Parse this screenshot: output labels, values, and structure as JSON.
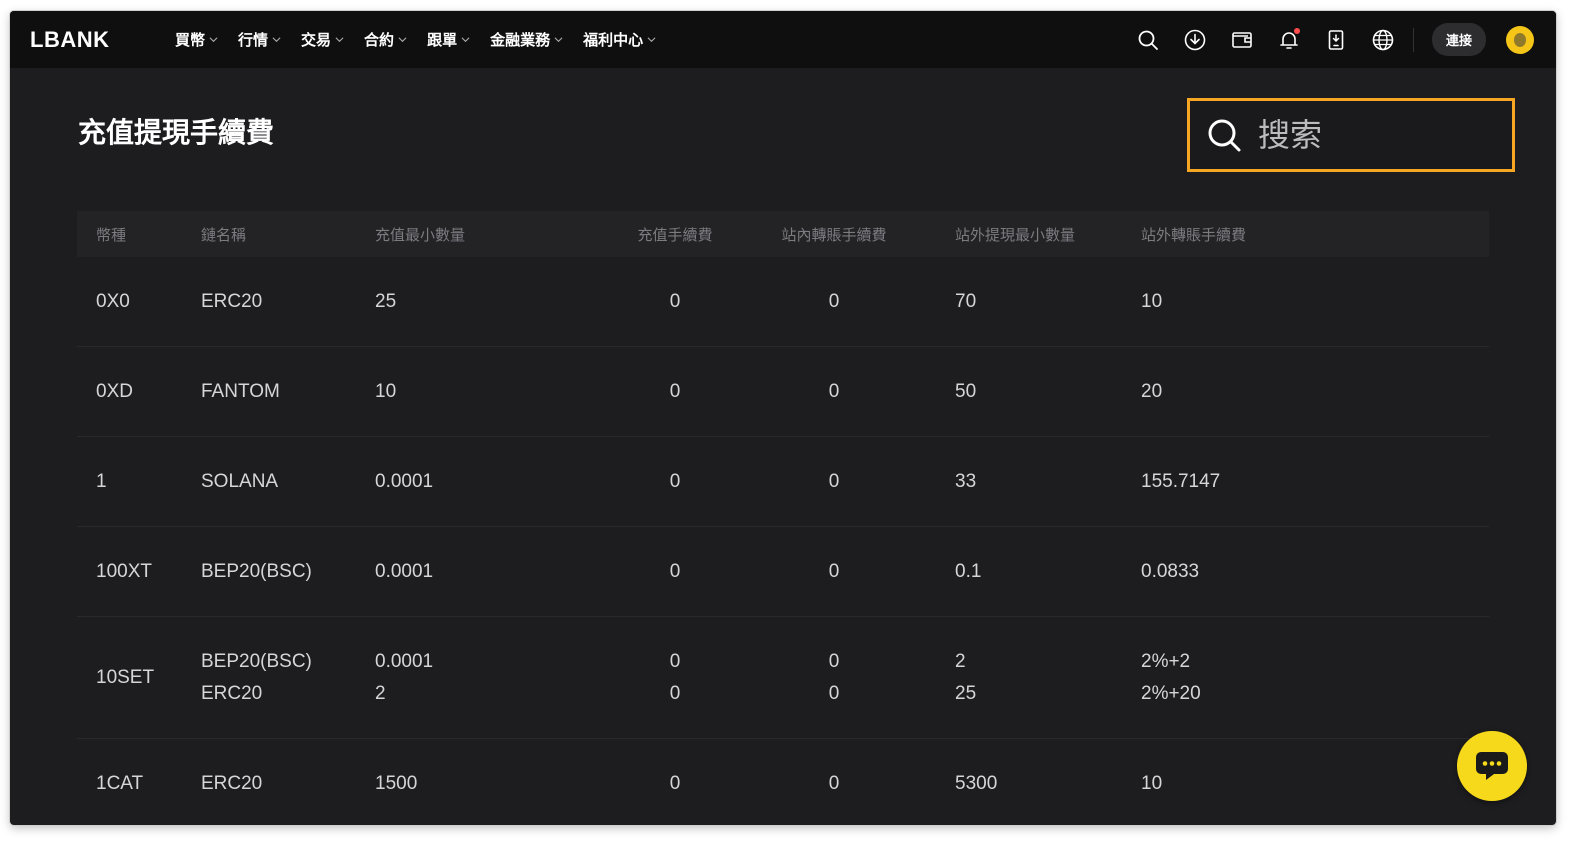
{
  "nav": {
    "logo": "LBANK",
    "menu": [
      {
        "label": "買幣"
      },
      {
        "label": "行情"
      },
      {
        "label": "交易"
      },
      {
        "label": "合約"
      },
      {
        "label": "跟單"
      },
      {
        "label": "金融業務"
      },
      {
        "label": "福利中心"
      }
    ],
    "icons": [
      "search-icon",
      "download-icon",
      "wallet-icon",
      "bell-icon",
      "mobile-icon",
      "globe-icon"
    ],
    "connect_label": "連接"
  },
  "page": {
    "title": "充值提現手續費"
  },
  "search": {
    "placeholder": "搜索",
    "accent": "#f5a623"
  },
  "table": {
    "headers": [
      "幣種",
      "鏈名稱",
      "充值最小數量",
      "充值手續費",
      "站內轉賬手續費",
      "站外提現最小數量",
      "站外轉賬手續費"
    ],
    "rows": [
      {
        "coin": "0X0",
        "chains": [
          {
            "chain": "ERC20",
            "min_deposit": "25",
            "deposit_fee": "0",
            "internal_fee": "0",
            "min_withdraw": "70",
            "withdraw_fee": "10"
          }
        ]
      },
      {
        "coin": "0XD",
        "chains": [
          {
            "chain": "FANTOM",
            "min_deposit": "10",
            "deposit_fee": "0",
            "internal_fee": "0",
            "min_withdraw": "50",
            "withdraw_fee": "20"
          }
        ]
      },
      {
        "coin": "1",
        "chains": [
          {
            "chain": "SOLANA",
            "min_deposit": "0.0001",
            "deposit_fee": "0",
            "internal_fee": "0",
            "min_withdraw": "33",
            "withdraw_fee": "155.7147"
          }
        ]
      },
      {
        "coin": "100XT",
        "chains": [
          {
            "chain": "BEP20(BSC)",
            "min_deposit": "0.0001",
            "deposit_fee": "0",
            "internal_fee": "0",
            "min_withdraw": "0.1",
            "withdraw_fee": "0.0833"
          }
        ]
      },
      {
        "coin": "10SET",
        "chains": [
          {
            "chain": "BEP20(BSC)",
            "min_deposit": "0.0001",
            "deposit_fee": "0",
            "internal_fee": "0",
            "min_withdraw": "2",
            "withdraw_fee": "2%+2"
          },
          {
            "chain": "ERC20",
            "min_deposit": "2",
            "deposit_fee": "0",
            "internal_fee": "0",
            "min_withdraw": "25",
            "withdraw_fee": "2%+20"
          }
        ]
      },
      {
        "coin": "1CAT",
        "chains": [
          {
            "chain": "ERC20",
            "min_deposit": "1500",
            "deposit_fee": "0",
            "internal_fee": "0",
            "min_withdraw": "5300",
            "withdraw_fee": "10"
          }
        ]
      }
    ]
  },
  "colors": {
    "background": "#1d1d20",
    "navbar": "#0f0f10",
    "brand_yellow": "#f5d91a",
    "notification_dot": "#ff4d4f"
  },
  "chat": {
    "icon": "chat-bubble-icon"
  }
}
